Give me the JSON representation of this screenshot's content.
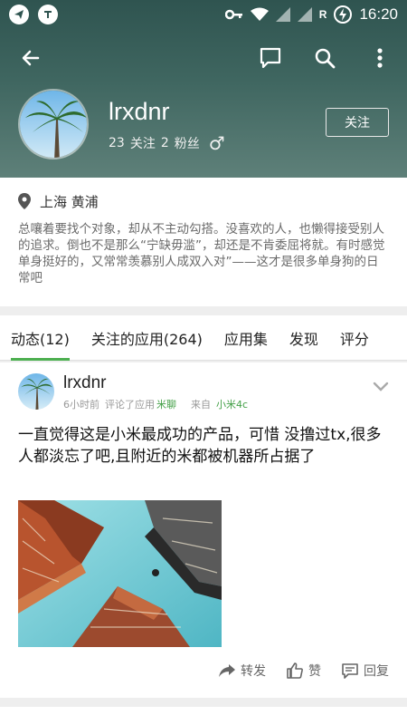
{
  "status_bar": {
    "time": "16:20",
    "network": "R"
  },
  "toolbar": {
    "back_icon": "arrow-left-icon",
    "icons": [
      "message-icon",
      "search-icon",
      "more-vert-icon"
    ]
  },
  "profile": {
    "name": "lrxdnr",
    "following_count": "23",
    "following_label": "关注",
    "fans_count": "2",
    "fans_label": "粉丝",
    "gender_symbol": "♂",
    "follow_button": "关注"
  },
  "bio": {
    "location": "上海 黄浦",
    "text": "总嚷着要找个对象，却从不主动勾搭。没喜欢的人，也懒得接受别人的追求。倒也不是那么“宁缺毋滥”，却还是不肯委屈将就。有时感觉单身挺好的，又常常羡慕别人成双入对”——这才是很多单身狗的日常吧"
  },
  "tabs": [
    {
      "label": "动态(12)",
      "active": true
    },
    {
      "label": "关注的应用(264)"
    },
    {
      "label": "应用集"
    },
    {
      "label": "发现"
    },
    {
      "label": "评分"
    }
  ],
  "post": {
    "author": "lrxdnr",
    "time": "6小时前",
    "action": "评论了应用",
    "app": "米聊",
    "from_label": "来自",
    "device": "小米4c",
    "body": "一直觉得这是小米最成功的产品，可惜 没撸过tx,很多人都淡忘了吧,且附近的米都被机器所占据了",
    "actions": {
      "forward": "转发",
      "like": "赞",
      "reply": "回复"
    }
  },
  "colors": {
    "header": "#3f6660",
    "accent": "#4caf50"
  }
}
